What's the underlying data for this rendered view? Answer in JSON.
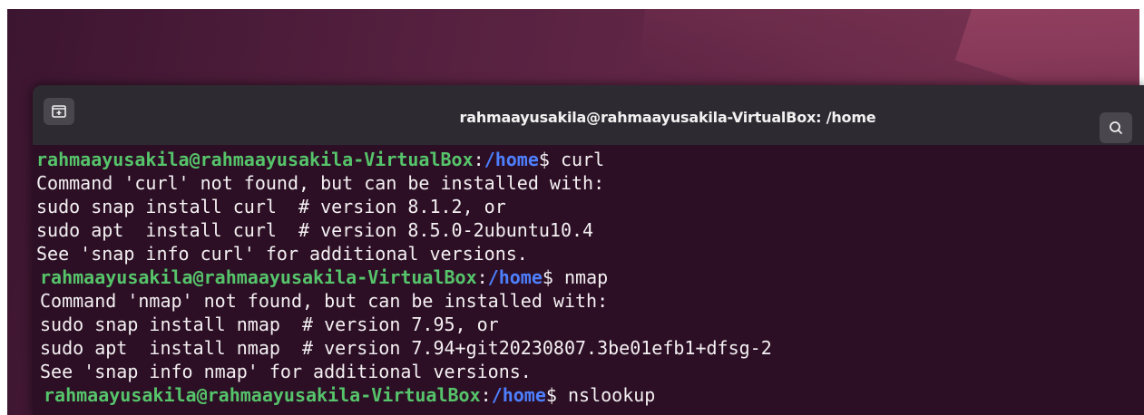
{
  "window": {
    "title": "rahmaayusakila@rahmaayusakila-VirtualBox: /home"
  },
  "icons": {
    "new_tab": "new-tab-icon",
    "search": "search-icon"
  },
  "colors": {
    "prompt_user": "#56c46a",
    "prompt_path": "#4d7fff",
    "text": "#f4f0f2",
    "terminal_bg": "#2c0f25",
    "titlebar_bg": "#2e2a31"
  },
  "terminal": {
    "prompt1": {
      "user": "rahmaayusakila@rahmaayusakila-VirtualBox",
      "sep": ":",
      "path": "/home",
      "cmd": "$ curl"
    },
    "out1": [
      "Command 'curl' not found, but can be installed with:",
      "sudo snap install curl  # version 8.1.2, or",
      "sudo apt  install curl  # version 8.5.0-2ubuntu10.4",
      "See 'snap info curl' for additional versions."
    ],
    "prompt2": {
      "user": "rahmaayusakila@rahmaayusakila-VirtualBox",
      "sep": ":",
      "path": "/home",
      "cmd": "$ nmap"
    },
    "out2": [
      "Command 'nmap' not found, but can be installed with:",
      "sudo snap install nmap  # version 7.95, or",
      "sudo apt  install nmap  # version 7.94+git20230807.3be01efb1+dfsg-2",
      "See 'snap info nmap' for additional versions."
    ],
    "prompt3": {
      "user": "rahmaayusakila@rahmaayusakila-VirtualBox",
      "sep": ":",
      "path": "/home",
      "cmd": "$ nslookup"
    }
  }
}
